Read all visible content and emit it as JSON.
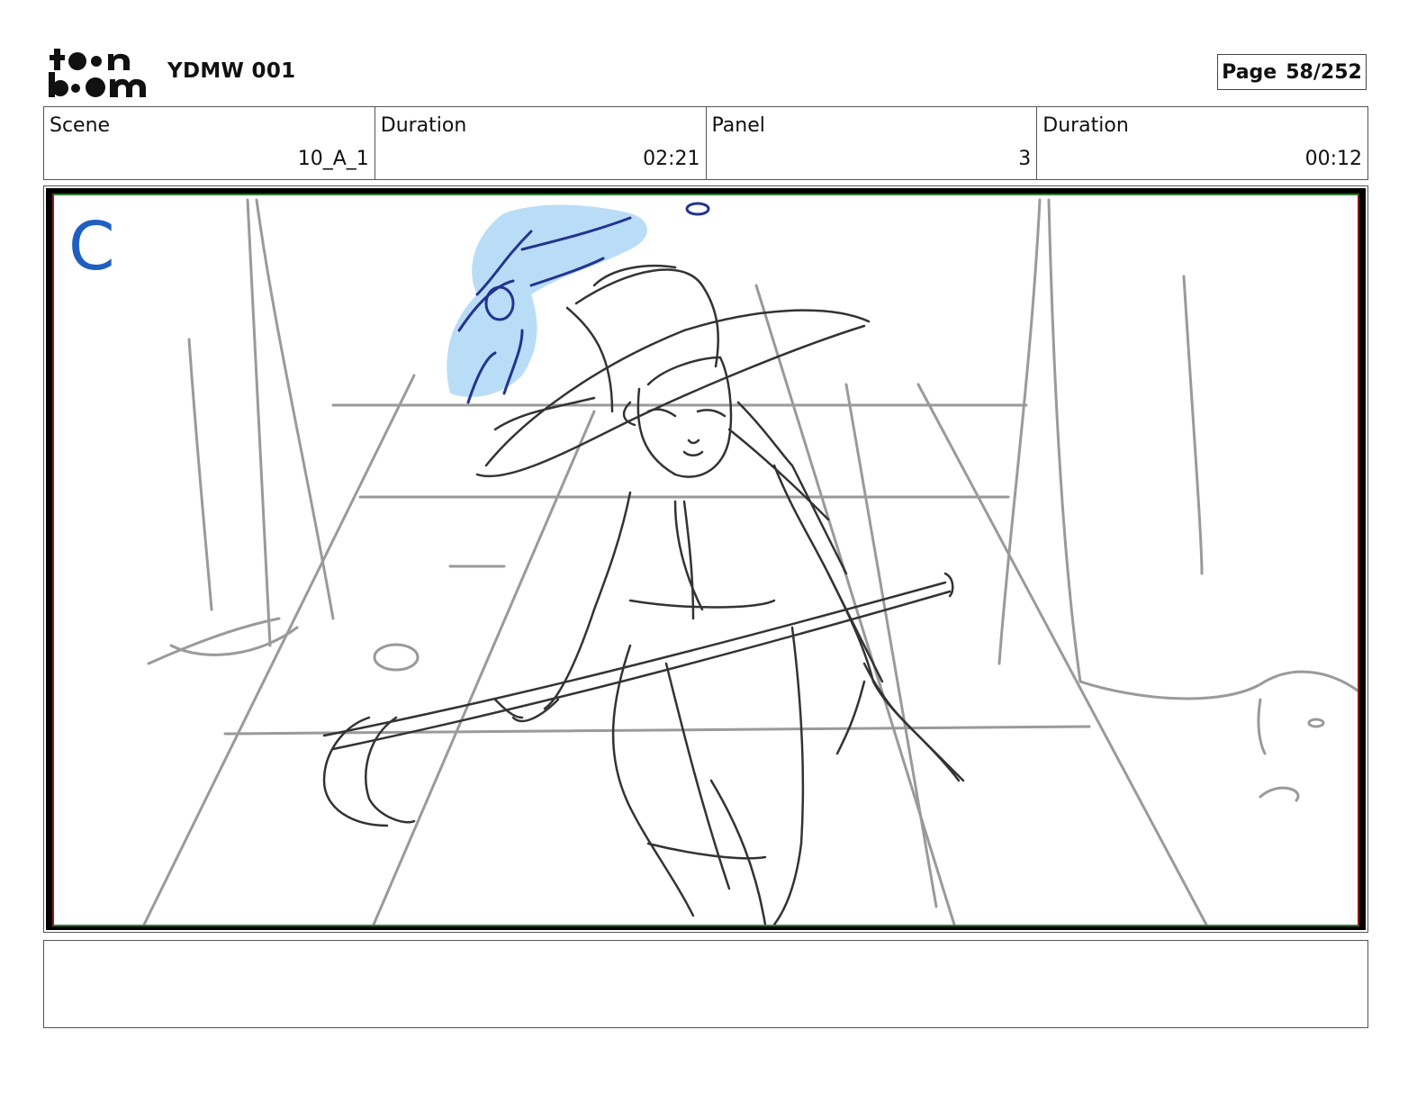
{
  "header": {
    "logo_text_top": "toon",
    "logo_text_bottom": "boom",
    "project_title": "YDMW 001",
    "page_label": "Page",
    "page_number": "58/252"
  },
  "info": {
    "scene_label": "Scene",
    "scene_value": "10_A_1",
    "scene_duration_label": "Duration",
    "scene_duration_value": "02:21",
    "panel_label": "Panel",
    "panel_value": "3",
    "panel_duration_label": "Duration",
    "panel_duration_value": "00:12"
  },
  "panel": {
    "layer_letter": "C"
  },
  "notes": {
    "text": ""
  }
}
